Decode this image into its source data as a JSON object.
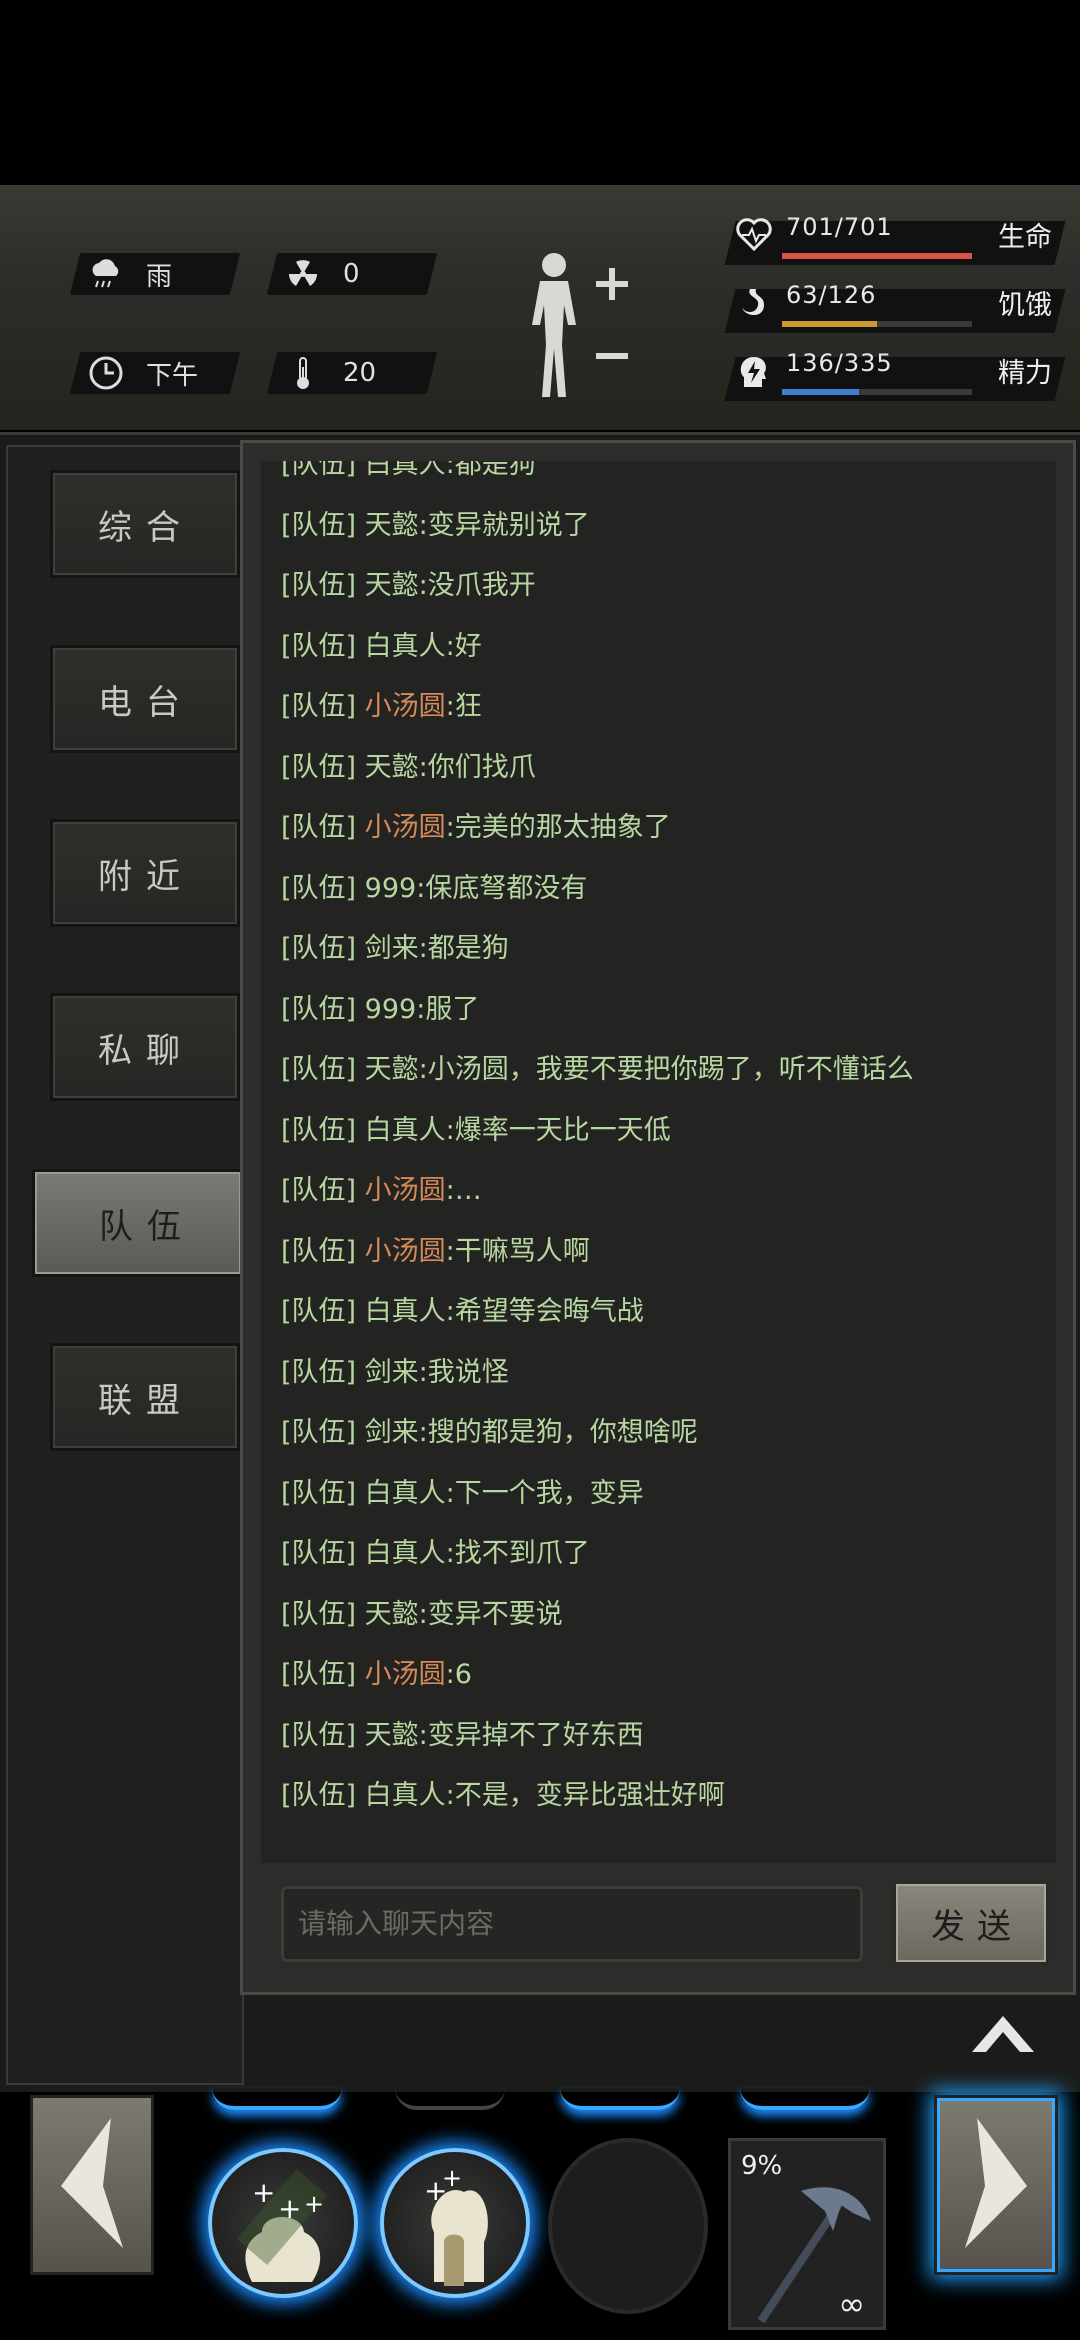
{
  "status": {
    "weather": "雨",
    "radiation": "0",
    "time_of_day": "下午",
    "temperature": "20"
  },
  "stats": [
    {
      "name": "生命",
      "value": "701/701",
      "fill": 1.0,
      "color": "#d9534a",
      "icon": "heart-icon"
    },
    {
      "name": "饥饿",
      "value": "63/126",
      "fill": 0.5,
      "color": "#c9992e",
      "icon": "stomach-icon"
    },
    {
      "name": "精力",
      "value": "136/335",
      "fill": 0.406,
      "color": "#3a7fd0",
      "icon": "energy-head-icon"
    }
  ],
  "tabs": [
    {
      "label": "综合",
      "active": false
    },
    {
      "label": "电台",
      "active": false
    },
    {
      "label": "附近",
      "active": false
    },
    {
      "label": "私聊",
      "active": false
    },
    {
      "label": "队伍",
      "active": true
    },
    {
      "label": "联盟",
      "active": false
    }
  ],
  "channel_tag": "[队伍]",
  "messages": [
    {
      "name": "白真人",
      "text": ":都是狗",
      "orange": false
    },
    {
      "name": "天懿",
      "text": ":变异就别说了",
      "orange": false
    },
    {
      "name": "天懿",
      "text": ":没爪我开",
      "orange": false
    },
    {
      "name": "白真人",
      "text": ":好",
      "orange": false
    },
    {
      "name": "小汤圆",
      "text": ":狂",
      "orange": true
    },
    {
      "name": "天懿",
      "text": ":你们找爪",
      "orange": false
    },
    {
      "name": "小汤圆",
      "text": ":完美的那太抽象了",
      "orange": true
    },
    {
      "name": "999",
      "text": ":保底弩都没有",
      "orange": false
    },
    {
      "name": "剑来",
      "text": ":都是狗",
      "orange": false
    },
    {
      "name": "999",
      "text": ":服了",
      "orange": false
    },
    {
      "name": "天懿",
      "text": ":小汤圆，我要不要把你踢了，听不懂话么",
      "orange": false
    },
    {
      "name": "白真人",
      "text": ":爆率一天比一天低",
      "orange": false
    },
    {
      "name": "小汤圆",
      "text": ":…",
      "orange": true
    },
    {
      "name": "小汤圆",
      "text": ":干嘛骂人啊",
      "orange": true
    },
    {
      "name": "白真人",
      "text": ":希望等会晦气战",
      "orange": false
    },
    {
      "name": "剑来",
      "text": ":我说怪",
      "orange": false
    },
    {
      "name": "剑来",
      "text": ":搜的都是狗，你想啥呢",
      "orange": false
    },
    {
      "name": "白真人",
      "text": ":下一个我，变异",
      "orange": false
    },
    {
      "name": "白真人",
      "text": ":找不到爪了",
      "orange": false
    },
    {
      "name": "天懿",
      "text": ":变异不要说",
      "orange": false
    },
    {
      "name": "小汤圆",
      "text": ":6",
      "orange": true
    },
    {
      "name": "天懿",
      "text": ":变异掉不了好东西",
      "orange": false
    },
    {
      "name": "白真人",
      "text": ":不是，变异比强壮好啊",
      "orange": false
    }
  ],
  "input": {
    "placeholder": "请输入聊天内容"
  },
  "send_label": "发送",
  "weapon": {
    "durability": "9%",
    "ammo": "∞"
  }
}
